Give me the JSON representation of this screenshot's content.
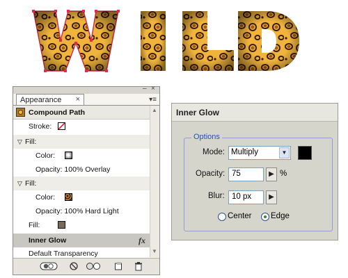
{
  "artwork": {
    "text": "WILD"
  },
  "appearance_panel": {
    "tab_label": "Appearance",
    "tab_close": "×",
    "panel_controls": [
      "–",
      "×"
    ],
    "menu_glyph": "▾≡",
    "object": {
      "label": "Compound Path"
    },
    "stroke": {
      "label": "Stroke:"
    },
    "fills": [
      {
        "label": "Fill:",
        "color_label": "Color:",
        "opacity": "Opacity: 100% Overlay",
        "expand": "▽"
      },
      {
        "label": "Fill:",
        "color_label": "Color:",
        "opacity": "Opacity: 100% Hard Light",
        "expand": "▽"
      }
    ],
    "plain_fill": {
      "label": "Fill:"
    },
    "effect": {
      "label": "Inner Glow",
      "fx": "fx"
    },
    "default_transparency": "Default Transparency"
  },
  "inner_glow": {
    "title": "Inner Glow",
    "options_legend": "Options",
    "mode": {
      "label": "Mode:",
      "value": "Multiply"
    },
    "opacity": {
      "label": "Opacity:",
      "value": "75",
      "unit": "%"
    },
    "blur": {
      "label": "Blur:",
      "value": "10 px"
    },
    "center_label": "Center",
    "edge_label": "Edge",
    "selected_position": "edge",
    "glow_color": "#000000"
  }
}
